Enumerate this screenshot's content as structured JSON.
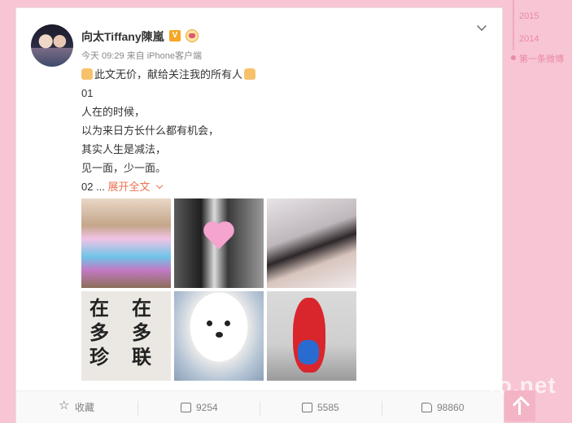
{
  "post": {
    "author": "向太Tiffany陳嵐",
    "verified_badge": "V",
    "meta": "今天 09:29 来自 iPhone客户端",
    "lines": [
      "此文无价，献给关注我的所有人",
      "01",
      "人在的时候，",
      "以为来日方长什么都有机会，",
      "其实人生是减法，",
      "见一面，少一面。",
      "02 ..."
    ],
    "expand_label": "展开全文",
    "calligraphy_left": "在\n多\n珍",
    "calligraphy_right": "在\n多\n联"
  },
  "actions": {
    "favorite_label": "收藏",
    "repost_count": "9254",
    "comment_count": "5585",
    "like_count": "98860"
  },
  "timeline": {
    "years": [
      "2015",
      "2014"
    ],
    "first_label": "第一条微博"
  },
  "watermark": "ro.net",
  "colors": {
    "background": "#f7c5d3",
    "accent": "#eb7350",
    "timeline": "#e98aa6"
  }
}
